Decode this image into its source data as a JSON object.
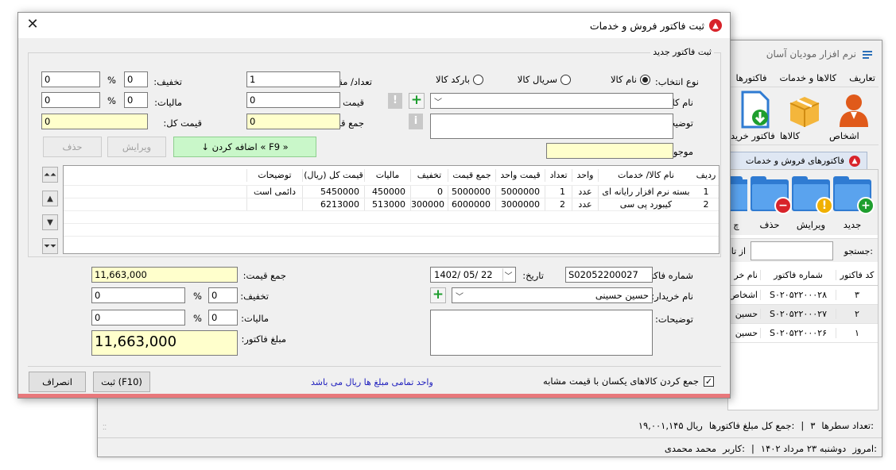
{
  "bg": {
    "title": "نرم افزار مودیان آسان",
    "menu": [
      "تعاریف",
      "کالاها و خدمات",
      "فاکتورها"
    ],
    "toolbar": [
      {
        "label": "اشخاص",
        "icon": "person-icon"
      },
      {
        "label": "کالاها",
        "icon": "box-icon"
      },
      {
        "label": "فاکتور خرید",
        "icon": "purchase-invoice-icon"
      }
    ],
    "tab_label": "فاکتورهای فروش و خدمات",
    "actions": [
      {
        "label": "جدید",
        "icon": "add-folder-icon"
      },
      {
        "label": "ویرایش",
        "icon": "edit-folder-icon"
      },
      {
        "label": "حذف",
        "icon": "delete-folder-icon"
      },
      {
        "label": "چ",
        "icon": "print-folder-icon"
      }
    ],
    "search_label": "جستجو:",
    "from_label": "از تار",
    "grid_headers": [
      "کد فاکتور",
      "شماره فاکتور",
      "نام خر"
    ],
    "grid_rows": [
      [
        "۳",
        "S۰۲۰۵۲۲۰۰۰۲۸",
        "اشخاص"
      ],
      [
        "۲",
        "S۰۲۰۵۲۲۰۰۰۲۷",
        "حسین"
      ],
      [
        "۱",
        "S۰۲۰۵۲۲۰۰۰۲۶",
        "حسین"
      ]
    ],
    "rows_count_label": "تعداد سطرها:",
    "rows_count": "۳",
    "total_label": "جمع کل مبلغ فاکتورها:",
    "total_value": "۱۹,۰۰۱,۱۴۵ ریال",
    "today_label": "امروز:",
    "today_value": "دوشنبه ۲۳ مرداد ۱۴۰۲",
    "user_label": "کاربر:",
    "user_value": "محمد محمدی"
  },
  "dialog": {
    "title": "ثبت فاکتور فروش و خدمات",
    "group_new": "ثبت فاکتور جدید",
    "select_type_label": "نوع انتخاب:",
    "radio_name": "نام کالا",
    "radio_serial": "سریال کالا",
    "radio_barcode": "بارکد کالا",
    "item_name_label": "نام کالا:",
    "desc_label": "توضیحات:",
    "stock_label": "موجودی:",
    "qty_label": "تعداد/ مقدار:",
    "qty_value": "1",
    "unit_price_label": "قیمت واحد:",
    "unit_price_value": "0",
    "sum_price_label": "جمع قیمت:",
    "sum_price_value": "0",
    "discount_label": "تخفیف:",
    "discount_pct": "0",
    "discount_amount": "0",
    "tax_label": "مالیات:",
    "tax_pct": "0",
    "tax_amount": "0",
    "total_price_label": "قیمت کل:",
    "total_price_value": "0",
    "pct_sign": "%",
    "add_button": "↓ اضافه کردن « F9 »",
    "edit_button": "ویرایش",
    "delete_button": "حذف",
    "grid_headers": [
      "ردیف",
      "نام کالا/ خدمات",
      "واحد",
      "تعداد",
      "قیمت واحد",
      "جمع قیمت",
      "تخفیف",
      "مالیات",
      "قیمت کل (ریال)",
      "توضیحات"
    ],
    "grid_rows": [
      [
        "1",
        "بسته نرم افزار رایانه ای",
        "عدد",
        "1",
        "5000000",
        "5000000",
        "0",
        "450000",
        "5450000",
        "دائمی است"
      ],
      [
        "2",
        "کیبورد پی سی",
        "عدد",
        "2",
        "3000000",
        "6000000",
        "300000",
        "513000",
        "6213000",
        ""
      ]
    ],
    "invoice_no_label": "شماره فاکتور:",
    "invoice_no_value": "S02052200027",
    "date_label": "تاریخ:",
    "date_value": "1402/ 05/ 22",
    "buyer_label": "نام خریدار:",
    "buyer_value": "حسین حسینی",
    "desc2_label": "توضیحات:",
    "sum_label": "جمع قیمت:",
    "sum_value": "11,663,000",
    "discount2_label": "تخفیف:",
    "discount2_pct": "0",
    "discount2_amount": "0",
    "tax2_label": "مالیات:",
    "tax2_pct": "0",
    "tax2_amount": "0",
    "amount_label": "مبلغ فاکتور:",
    "amount_value": "11,663,000",
    "merge_checkbox": "جمع کردن کالاهای یکسان با قیمت مشابه",
    "currency_note": "واحد تمامی مبلغ ها ریال می باشد",
    "save_button": "ثبت (F10)",
    "cancel_button": "انصراف"
  }
}
